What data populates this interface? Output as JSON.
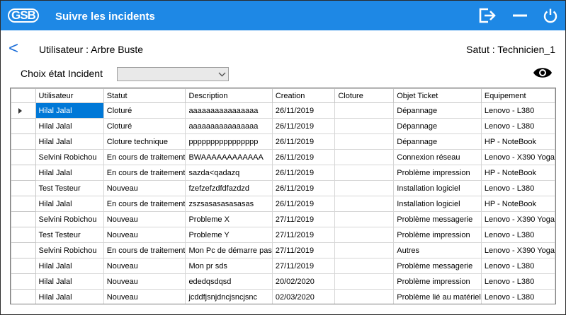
{
  "app": {
    "logo_text": "GSB",
    "title": "Suivre les incidents"
  },
  "header": {
    "back_label": "<",
    "user_label": "Utilisateur : Arbre Buste",
    "satut_label": "Satut : Technicien_1"
  },
  "filter": {
    "label": "Choix état Incident",
    "selected_value": ""
  },
  "icons": {
    "logout": "logout-icon",
    "minimize": "minimize-icon",
    "power": "power-icon",
    "eye": "eye-icon",
    "dropdown": "chevron-down-icon"
  },
  "colors": {
    "titlebar": "#1e88e5",
    "selection": "#0078d7",
    "back_arrow": "#1e6fd9",
    "grid_background": "#a8a8a8"
  },
  "table": {
    "columns": [
      "Utilisateur",
      "Statut",
      "Description",
      "Creation",
      "Cloture",
      "Objet Ticket",
      "Equipement"
    ],
    "rows": [
      [
        "Hilal Jalal",
        "Cloturé",
        "aaaaaaaaaaaaaaaa",
        "26/11/2019",
        "",
        "Dépannage",
        "Lenovo - L380"
      ],
      [
        "Hilal Jalal",
        "Cloturé",
        "aaaaaaaaaaaaaaaa",
        "26/11/2019",
        "",
        "Dépannage",
        "Lenovo - L380"
      ],
      [
        "Hilal Jalal",
        "Cloture technique",
        "pppppppppppppppp",
        "26/11/2019",
        "",
        "Dépannage",
        "HP - NoteBook"
      ],
      [
        "Selvini Robichou",
        "En cours de traitement",
        "BWAAAAAAAAAAAA",
        "26/11/2019",
        "",
        "Connexion réseau",
        "Lenovo - X390 Yoga"
      ],
      [
        "Hilal Jalal",
        "En cours de traitement",
        "sazda<qadazq",
        "26/11/2019",
        "",
        "Problème impression",
        "HP - NoteBook"
      ],
      [
        "Test Testeur",
        "Nouveau",
        "fzefzefzdfdfazdzd",
        "26/11/2019",
        "",
        "Installation logiciel",
        "Lenovo - L380"
      ],
      [
        "Hilal Jalal",
        "En cours de traitement",
        "zszsasasasasasas",
        "26/11/2019",
        "",
        "Installation logiciel",
        "HP - NoteBook"
      ],
      [
        "Selvini Robichou",
        "Nouveau",
        "Probleme X",
        "27/11/2019",
        "",
        "Problème messagerie",
        "Lenovo - X390 Yoga"
      ],
      [
        "Test Testeur",
        "Nouveau",
        "Probleme Y",
        "27/11/2019",
        "",
        "Problème impression",
        "Lenovo - L380"
      ],
      [
        "Selvini Robichou",
        "En cours de traitement",
        "Mon Pc de démarre pas",
        "27/11/2019",
        "",
        "Autres",
        "Lenovo - X390 Yoga"
      ],
      [
        "Hilal Jalal",
        "Nouveau",
        "Mon pr sds",
        "27/11/2019",
        "",
        "Problème messagerie",
        "Lenovo - L380"
      ],
      [
        "Hilal Jalal",
        "Nouveau",
        "ededqsdqsd",
        "20/02/2020",
        "",
        "Problème impression",
        "Lenovo - L380"
      ],
      [
        "Hilal Jalal",
        "Nouveau",
        "jcddfjsnjdncjsncjsnc",
        "02/03/2020",
        "",
        "Problème lié au matériel",
        "Lenovo - L380"
      ]
    ],
    "selected_row": 0
  }
}
